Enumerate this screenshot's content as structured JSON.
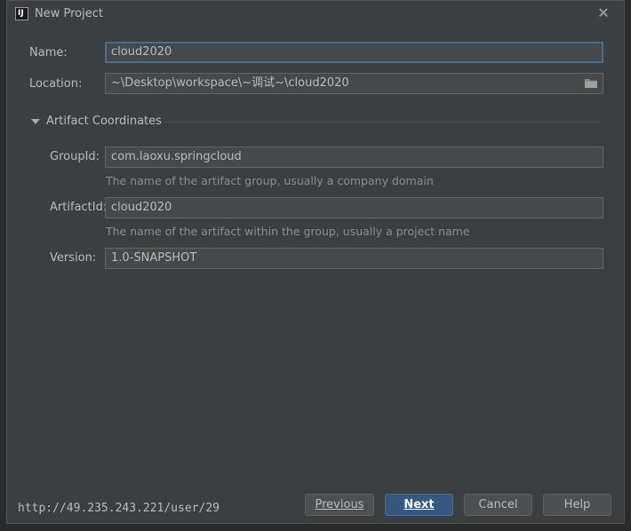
{
  "window": {
    "title": "New Project",
    "app_icon_text": "IJ"
  },
  "form": {
    "name_label": "Name:",
    "name_value": "cloud2020",
    "location_label": "Location:",
    "location_value": "~\\Desktop\\workspace\\~调试~\\cloud2020"
  },
  "artifact": {
    "section_title": "Artifact Coordinates",
    "groupid_label": "GroupId:",
    "groupid_value": "com.laoxu.springcloud",
    "groupid_hint": "The name of the artifact group, usually a company domain",
    "artifactid_label": "ArtifactId:",
    "artifactid_value": "cloud2020",
    "artifactid_hint": "The name of the artifact within the group, usually a project name",
    "version_label": "Version:",
    "version_value": "1.0-SNAPSHOT"
  },
  "footer": {
    "url": "http://49.235.243.221/user/29",
    "previous_label": "Previous",
    "next_label": "Next",
    "cancel_label": "Cancel",
    "help_label": "Help"
  },
  "colors": {
    "dialog_bg": "#3c3f41",
    "field_bg": "#45494a",
    "focus_border": "#466d94",
    "primary_button": "#365880"
  }
}
